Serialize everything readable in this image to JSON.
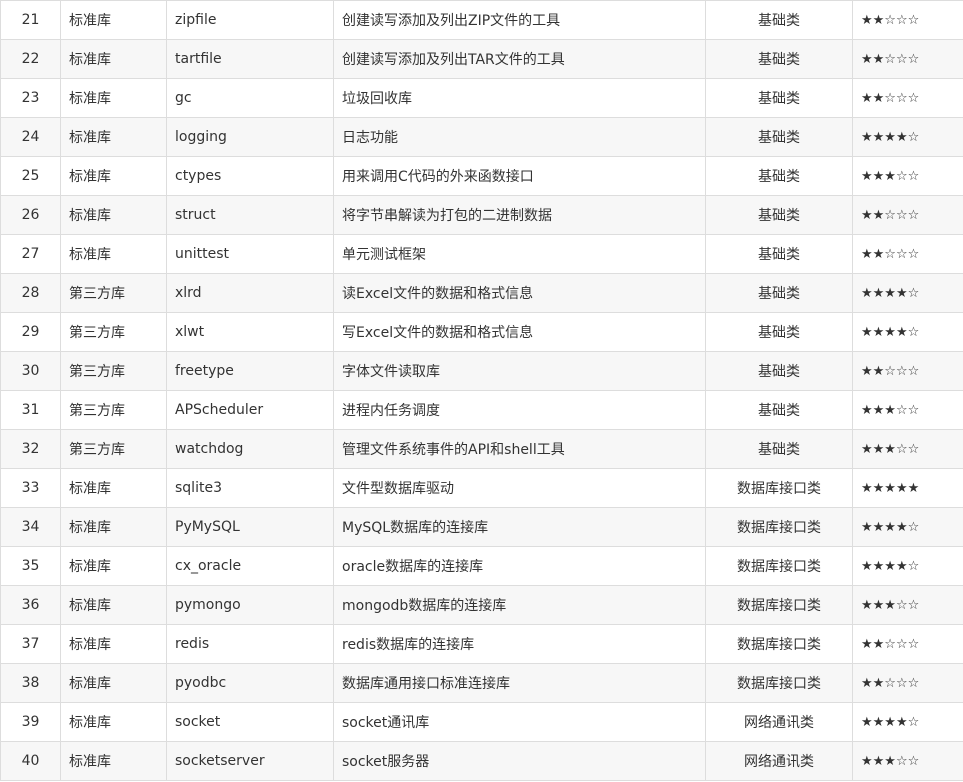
{
  "table": {
    "rows": [
      {
        "no": "21",
        "source": "标准库",
        "name": "zipfile",
        "desc": "创建读写添加及列出ZIP文件的工具",
        "category": "基础类",
        "rating": "★★☆☆☆"
      },
      {
        "no": "22",
        "source": "标准库",
        "name": "tartfile",
        "desc": "创建读写添加及列出TAR文件的工具",
        "category": "基础类",
        "rating": "★★☆☆☆"
      },
      {
        "no": "23",
        "source": "标准库",
        "name": "gc",
        "desc": "垃圾回收库",
        "category": "基础类",
        "rating": "★★☆☆☆"
      },
      {
        "no": "24",
        "source": "标准库",
        "name": "logging",
        "desc": "日志功能",
        "category": "基础类",
        "rating": "★★★★☆"
      },
      {
        "no": "25",
        "source": "标准库",
        "name": "ctypes",
        "desc": "用来调用C代码的外来函数接口",
        "category": "基础类",
        "rating": "★★★☆☆"
      },
      {
        "no": "26",
        "source": "标准库",
        "name": "struct",
        "desc": "将字节串解读为打包的二进制数据",
        "category": "基础类",
        "rating": "★★☆☆☆"
      },
      {
        "no": "27",
        "source": "标准库",
        "name": "unittest",
        "desc": "单元测试框架",
        "category": "基础类",
        "rating": "★★☆☆☆"
      },
      {
        "no": "28",
        "source": "第三方库",
        "name": "xlrd",
        "desc": "读Excel文件的数据和格式信息",
        "category": "基础类",
        "rating": "★★★★☆"
      },
      {
        "no": "29",
        "source": "第三方库",
        "name": "xlwt",
        "desc": "写Excel文件的数据和格式信息",
        "category": "基础类",
        "rating": "★★★★☆"
      },
      {
        "no": "30",
        "source": "第三方库",
        "name": "freetype",
        "desc": "字体文件读取库",
        "category": "基础类",
        "rating": "★★☆☆☆"
      },
      {
        "no": "31",
        "source": "第三方库",
        "name": "APScheduler",
        "desc": "进程内任务调度",
        "category": "基础类",
        "rating": "★★★☆☆"
      },
      {
        "no": "32",
        "source": "第三方库",
        "name": "watchdog",
        "desc": "管理文件系统事件的API和shell工具",
        "category": "基础类",
        "rating": "★★★☆☆"
      },
      {
        "no": "33",
        "source": "标准库",
        "name": "sqlite3",
        "desc": "文件型数据库驱动",
        "category": "数据库接口类",
        "rating": "★★★★★"
      },
      {
        "no": "34",
        "source": "标准库",
        "name": "PyMySQL",
        "desc": "MySQL数据库的连接库",
        "category": "数据库接口类",
        "rating": "★★★★☆"
      },
      {
        "no": "35",
        "source": "标准库",
        "name": "cx_oracle",
        "desc": "oracle数据库的连接库",
        "category": "数据库接口类",
        "rating": "★★★★☆"
      },
      {
        "no": "36",
        "source": "标准库",
        "name": "pymongo",
        "desc": "mongodb数据库的连接库",
        "category": "数据库接口类",
        "rating": "★★★☆☆"
      },
      {
        "no": "37",
        "source": "标准库",
        "name": "redis",
        "desc": "redis数据库的连接库",
        "category": "数据库接口类",
        "rating": "★★☆☆☆"
      },
      {
        "no": "38",
        "source": "标准库",
        "name": "pyodbc",
        "desc": "数据库通用接口标准连接库",
        "category": "数据库接口类",
        "rating": "★★☆☆☆"
      },
      {
        "no": "39",
        "source": "标准库",
        "name": "socket",
        "desc": "socket通讯库",
        "category": "网络通讯类",
        "rating": "★★★★☆"
      },
      {
        "no": "40",
        "source": "标准库",
        "name": "socketserver",
        "desc": "socket服务器",
        "category": "网络通讯类",
        "rating": "★★★☆☆"
      }
    ]
  }
}
